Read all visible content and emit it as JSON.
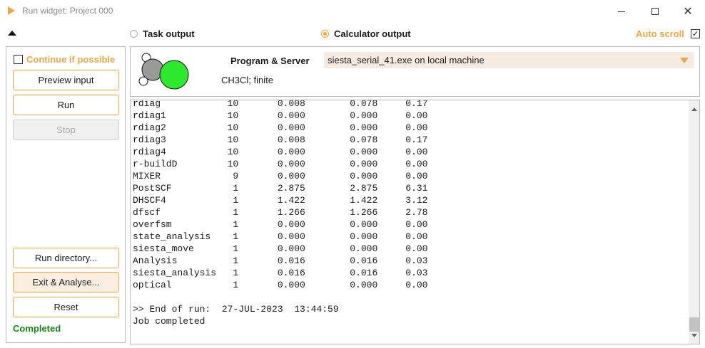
{
  "window": {
    "title": "Run widget: Project 000",
    "close_glyph": "✕"
  },
  "output_tabs": {
    "task_output": "Task output",
    "calculator_output": "Calculator output",
    "selected": "calculator_output"
  },
  "auto_scroll": {
    "label": "Auto scroll",
    "checked": true,
    "check_glyph": "✓"
  },
  "left_panel": {
    "continue_if_possible": {
      "label": "Continue if possible",
      "checked": false
    },
    "buttons": {
      "preview_input": "Preview input",
      "run": "Run",
      "stop": "Stop",
      "run_directory": "Run directory...",
      "exit_analyse": "Exit & Analyse...",
      "reset": "Reset"
    },
    "status": "Completed"
  },
  "program": {
    "label": "Program & Server",
    "selected_value": "siesta_serial_41.exe on local machine",
    "molecule": "CH3Cl; finite"
  },
  "output": {
    "rows": [
      [
        "rdiag",
        "10",
        "0.008",
        "0.078",
        "0.17"
      ],
      [
        "rdiag1",
        "10",
        "0.000",
        "0.000",
        "0.00"
      ],
      [
        "rdiag2",
        "10",
        "0.000",
        "0.000",
        "0.00"
      ],
      [
        "rdiag3",
        "10",
        "0.008",
        "0.078",
        "0.17"
      ],
      [
        "rdiag4",
        "10",
        "0.000",
        "0.000",
        "0.00"
      ],
      [
        "r-buildD",
        "10",
        "0.000",
        "0.000",
        "0.00"
      ],
      [
        "MIXER",
        "9",
        "0.000",
        "0.000",
        "0.00"
      ],
      [
        "PostSCF",
        "1",
        "2.875",
        "2.875",
        "6.31"
      ],
      [
        "DHSCF4",
        "1",
        "1.422",
        "1.422",
        "3.12"
      ],
      [
        "dfscf",
        "1",
        "1.266",
        "1.266",
        "2.78"
      ],
      [
        "overfsm",
        "1",
        "0.000",
        "0.000",
        "0.00"
      ],
      [
        "state_analysis",
        "1",
        "0.000",
        "0.000",
        "0.00"
      ],
      [
        "siesta_move",
        "1",
        "0.000",
        "0.000",
        "0.00"
      ],
      [
        "Analysis",
        "1",
        "0.016",
        "0.016",
        "0.03"
      ],
      [
        "siesta_analysis",
        "1",
        "0.016",
        "0.016",
        "0.03"
      ],
      [
        "optical",
        "1",
        "0.000",
        "0.000",
        "0.00"
      ]
    ],
    "end_of_run": ">> End of run:  27-JUL-2023  13:44:59",
    "job_status": "Job completed"
  },
  "colors": {
    "accent": "#e8a84f",
    "completed": "#1a7f1a",
    "select_bg": "#f6ebe1",
    "molecule_carbon": "#9a9a9a",
    "molecule_chlorine": "#2ee82e",
    "molecule_hydrogen": "#ffffff"
  }
}
